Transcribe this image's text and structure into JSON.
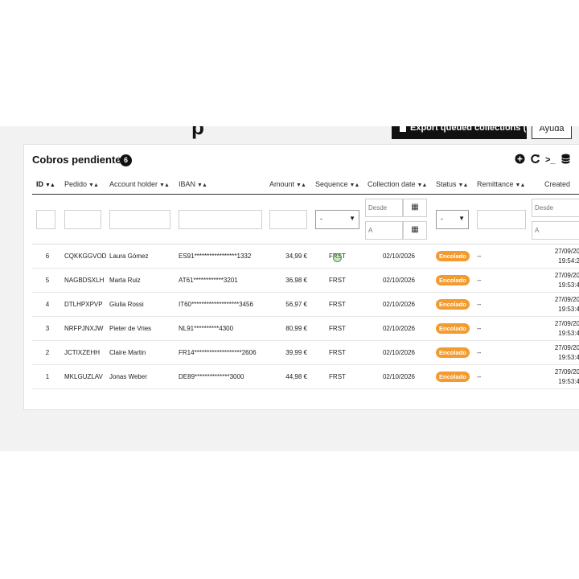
{
  "header": {
    "title_fragment": "p",
    "export_button_label": "Export queued collections (CSV)",
    "help_button_label": "Ayuda"
  },
  "card": {
    "title": "Cobros pendientes",
    "count": "6",
    "tools": [
      "plus-circle-icon",
      "refresh-icon",
      "terminal-icon",
      "database-icon"
    ]
  },
  "table": {
    "columns": [
      "ID",
      "Pedido",
      "Account holder",
      "IBAN",
      "Amount",
      "Sequence",
      "Collection date",
      "Status",
      "Remittance",
      "Created"
    ],
    "sort_glyph": "▼▲",
    "filters": {
      "select_value": "-",
      "date_from_placeholder": "Desde",
      "date_to_placeholder": "A"
    },
    "rows": [
      {
        "id": "6",
        "pedido": "CQKKGGVOD",
        "holder": "Laura Gómez",
        "iban": "ES91*****************1332",
        "amount": "34,99 €",
        "sequence": "FRST",
        "date": "02/10/2026",
        "status": "Encolado",
        "remittance": "--",
        "created_date": "27/09/20",
        "created_time": "19:54:2"
      },
      {
        "id": "5",
        "pedido": "NAGBDSXLH",
        "holder": "Marta Ruiz",
        "iban": "AT61************3201",
        "amount": "36,98 €",
        "sequence": "FRST",
        "date": "02/10/2026",
        "status": "Encolado",
        "remittance": "--",
        "created_date": "27/09/20",
        "created_time": "19:53:4"
      },
      {
        "id": "4",
        "pedido": "DTLHPXPVP",
        "holder": "Giulia Rossi",
        "iban": "IT60*******************3456",
        "amount": "56,97 €",
        "sequence": "FRST",
        "date": "02/10/2026",
        "status": "Encolado",
        "remittance": "--",
        "created_date": "27/09/20",
        "created_time": "19:53:4"
      },
      {
        "id": "3",
        "pedido": "NRFPJNXJW",
        "holder": "Pieter de Vries",
        "iban": "NL91**********4300",
        "amount": "80,99 €",
        "sequence": "FRST",
        "date": "02/10/2026",
        "status": "Encolado",
        "remittance": "--",
        "created_date": "27/09/20",
        "created_time": "19:53:4"
      },
      {
        "id": "2",
        "pedido": "JCTIXZEHH",
        "holder": "Claire Martin",
        "iban": "FR14*******************2606",
        "amount": "39,99 €",
        "sequence": "FRST",
        "date": "02/10/2026",
        "status": "Encolado",
        "remittance": "--",
        "created_date": "27/09/20",
        "created_time": "19:53:4"
      },
      {
        "id": "1",
        "pedido": "MKLGUZLAV",
        "holder": "Jonas Weber",
        "iban": "DE89**************3000",
        "amount": "44,98 €",
        "sequence": "FRST",
        "date": "02/10/2026",
        "status": "Encolado",
        "remittance": "--",
        "created_date": "27/09/20",
        "created_time": "19:53:4"
      }
    ]
  },
  "colors": {
    "status_badge": "#f39b2f",
    "page_background": "#f2f2f2",
    "primary_dark": "#111111"
  }
}
